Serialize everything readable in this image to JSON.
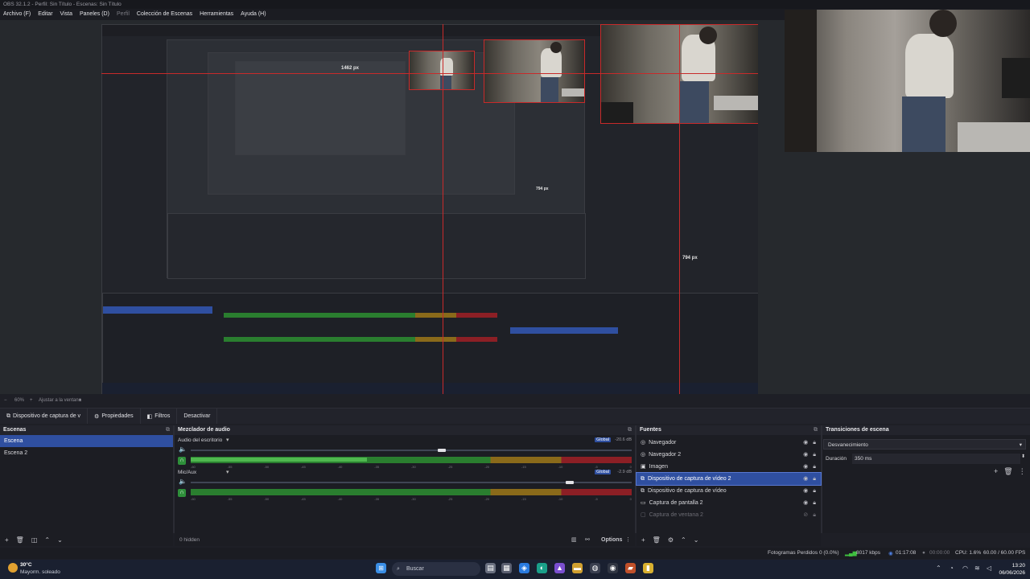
{
  "window": {
    "title": "OBS 32.1.2 - Perfil: Sin Título - Escenas: Sin Título"
  },
  "menu": {
    "items": [
      "Archivo (F)",
      "Editar",
      "Vista",
      "Paneles (D)",
      "Perfil",
      "Colección de Escenas",
      "Herramientas",
      "Ayuda (H)"
    ],
    "disabled_item": "Perfil"
  },
  "preview": {
    "measure_width": "1462 px",
    "measure_height_a": "794 px",
    "measure_height_b": "794 px",
    "guide_color": "#c82a2a"
  },
  "zoombar": {
    "zoom": "60%",
    "fit_label": "Ajustar a la ventana"
  },
  "source_toolbar": {
    "source_name": "Dispositivo de captura de v",
    "properties": "Propiedades",
    "filters": "Filtros",
    "deactivate": "Desactivar"
  },
  "scenes": {
    "title": "Escenas",
    "items": [
      "Escena",
      "Escena 2"
    ],
    "selected": "Escena"
  },
  "mixer": {
    "title": "Mezclador de audio",
    "channels": [
      {
        "name": "Audio del escritorio",
        "global": "Global",
        "db": "-20.6 dB",
        "volume_fraction": 0.57,
        "level_fraction": 0.4
      },
      {
        "name": "Mic/Aux",
        "global": "Global",
        "db": "-2.9 dB",
        "volume_fraction": 0.86,
        "level_fraction": 0.0
      }
    ],
    "ticks": [
      "-60",
      "-55",
      "-50",
      "-45",
      "-40",
      "-35",
      "-30",
      "-25",
      "-20",
      "-15",
      "-10",
      "-5",
      "0"
    ],
    "hidden_label": "0 hidden",
    "options_label": "Options"
  },
  "sources": {
    "title": "Fuentes",
    "items": [
      {
        "label": "Navegador",
        "icon": "browser-icon",
        "visible": true,
        "state": "normal"
      },
      {
        "label": "Navegador 2",
        "icon": "browser-icon",
        "visible": true,
        "state": "normal"
      },
      {
        "label": "Imagen",
        "icon": "image-icon",
        "visible": true,
        "state": "normal"
      },
      {
        "label": "Dispositivo de captura de vídeo 2",
        "icon": "camera-icon",
        "visible": true,
        "state": "selected"
      },
      {
        "label": "Dispositivo de captura de vídeo",
        "icon": "camera-icon",
        "visible": true,
        "state": "normal"
      },
      {
        "label": "Captura de pantalla 2",
        "icon": "monitor-icon",
        "visible": true,
        "state": "normal"
      },
      {
        "label": "Captura de ventana 2",
        "icon": "window-icon",
        "visible": false,
        "state": "dim"
      }
    ]
  },
  "transitions": {
    "title": "Transiciones de escena",
    "selected": "Desvanecimiento",
    "duration_label": "Duración",
    "duration_value": "350 ms"
  },
  "status": {
    "dropped": "Fotogramas Perdidos 0 (0.0%)",
    "bitrate": "8017 kbps",
    "stream_time": "01:17:08",
    "rec_time": "00:00:00",
    "cpu": "CPU: 1.6%",
    "fps": "60.00 / 60.00 FPS"
  },
  "taskbar": {
    "weather_temp": "30°C",
    "weather_desc": "Mayorm. soleado",
    "search_placeholder": "Buscar",
    "time": "13:20",
    "date": "06/06/2026"
  }
}
